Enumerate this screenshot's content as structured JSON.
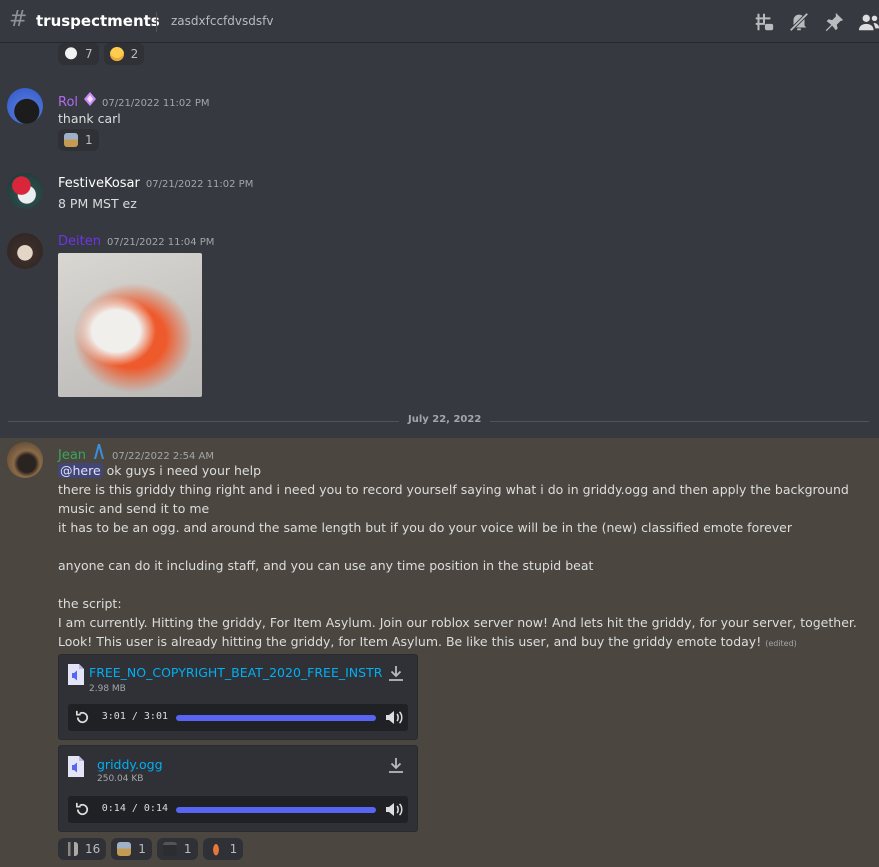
{
  "header": {
    "hash_icon": "#",
    "channel_name": "truspectments",
    "topic": "zasdxfccfdvsdsfv",
    "icons": [
      "threads-icon",
      "mute-bell-icon",
      "pin-icon",
      "members-icon"
    ]
  },
  "top_reactions": [
    {
      "emoji": "skull-emoji",
      "count": "7"
    },
    {
      "emoji": "nerd-face-emoji",
      "count": "2"
    }
  ],
  "messages": [
    {
      "author": "Rol",
      "author_color": "#b26aed",
      "badge": "crystal-badge-icon",
      "timestamp": "07/21/2022 11:02 PM",
      "text": "thank carl",
      "reactions": [
        {
          "emoji": "custom-image-emoji",
          "count": "1"
        }
      ]
    },
    {
      "author": "FestiveKosar",
      "author_color": "#ffffff",
      "timestamp": "07/21/2022 11:02 PM",
      "text": "8 PM MST ez"
    },
    {
      "author": "Deiten",
      "author_color": "#6c36e8",
      "timestamp": "07/21/2022 11:04 PM",
      "attachment": "image-attachment"
    }
  ],
  "date_divider": "July 22, 2022",
  "jean": {
    "author": "Jean",
    "author_color": "#3ba55d",
    "badge": "blue-arch-badge-icon",
    "timestamp": "07/22/2022 2:54 AM",
    "mention": "@here",
    "line1_rest": " ok guys i need your help",
    "line2": "there is this griddy thing right and i need you to record yourself saying what i do in griddy.ogg and then apply the background",
    "line3": "music and send it to me",
    "line4": "it has to be an ogg. and around the same length but if you do your voice will be in the (new) classified emote forever",
    "line5": "anyone can do it including staff, and you can use any time position in the stupid beat",
    "line6": "the script:",
    "line7": "I am currently. Hitting the griddy, For Item Asylum. Join our roblox server now! And lets hit the griddy, for your server, together.",
    "line8": "Look! This user is already hitting the griddy, for Item Asylum. Be like this user, and buy the griddy emote today!",
    "edited": "(edited)",
    "audio": [
      {
        "file_name": "FREE_NO_COPYRIGHT_BEAT_2020_FREE_INSTR",
        "size": "2.98 MB",
        "time": "3:01 / 3:01",
        "progress": 1.0
      },
      {
        "file_name": "griddy.ogg",
        "size": "250.04 KB",
        "time": "0:14 / 0:14",
        "progress": 1.0
      }
    ],
    "reactions": [
      {
        "emoji": "custom-dancing-emoji",
        "count": "16"
      },
      {
        "emoji": "custom-image-emoji",
        "count": "1"
      },
      {
        "emoji": "custom-dark-emoji",
        "count": "1"
      },
      {
        "emoji": "custom-figure-emoji",
        "count": "1"
      }
    ]
  }
}
